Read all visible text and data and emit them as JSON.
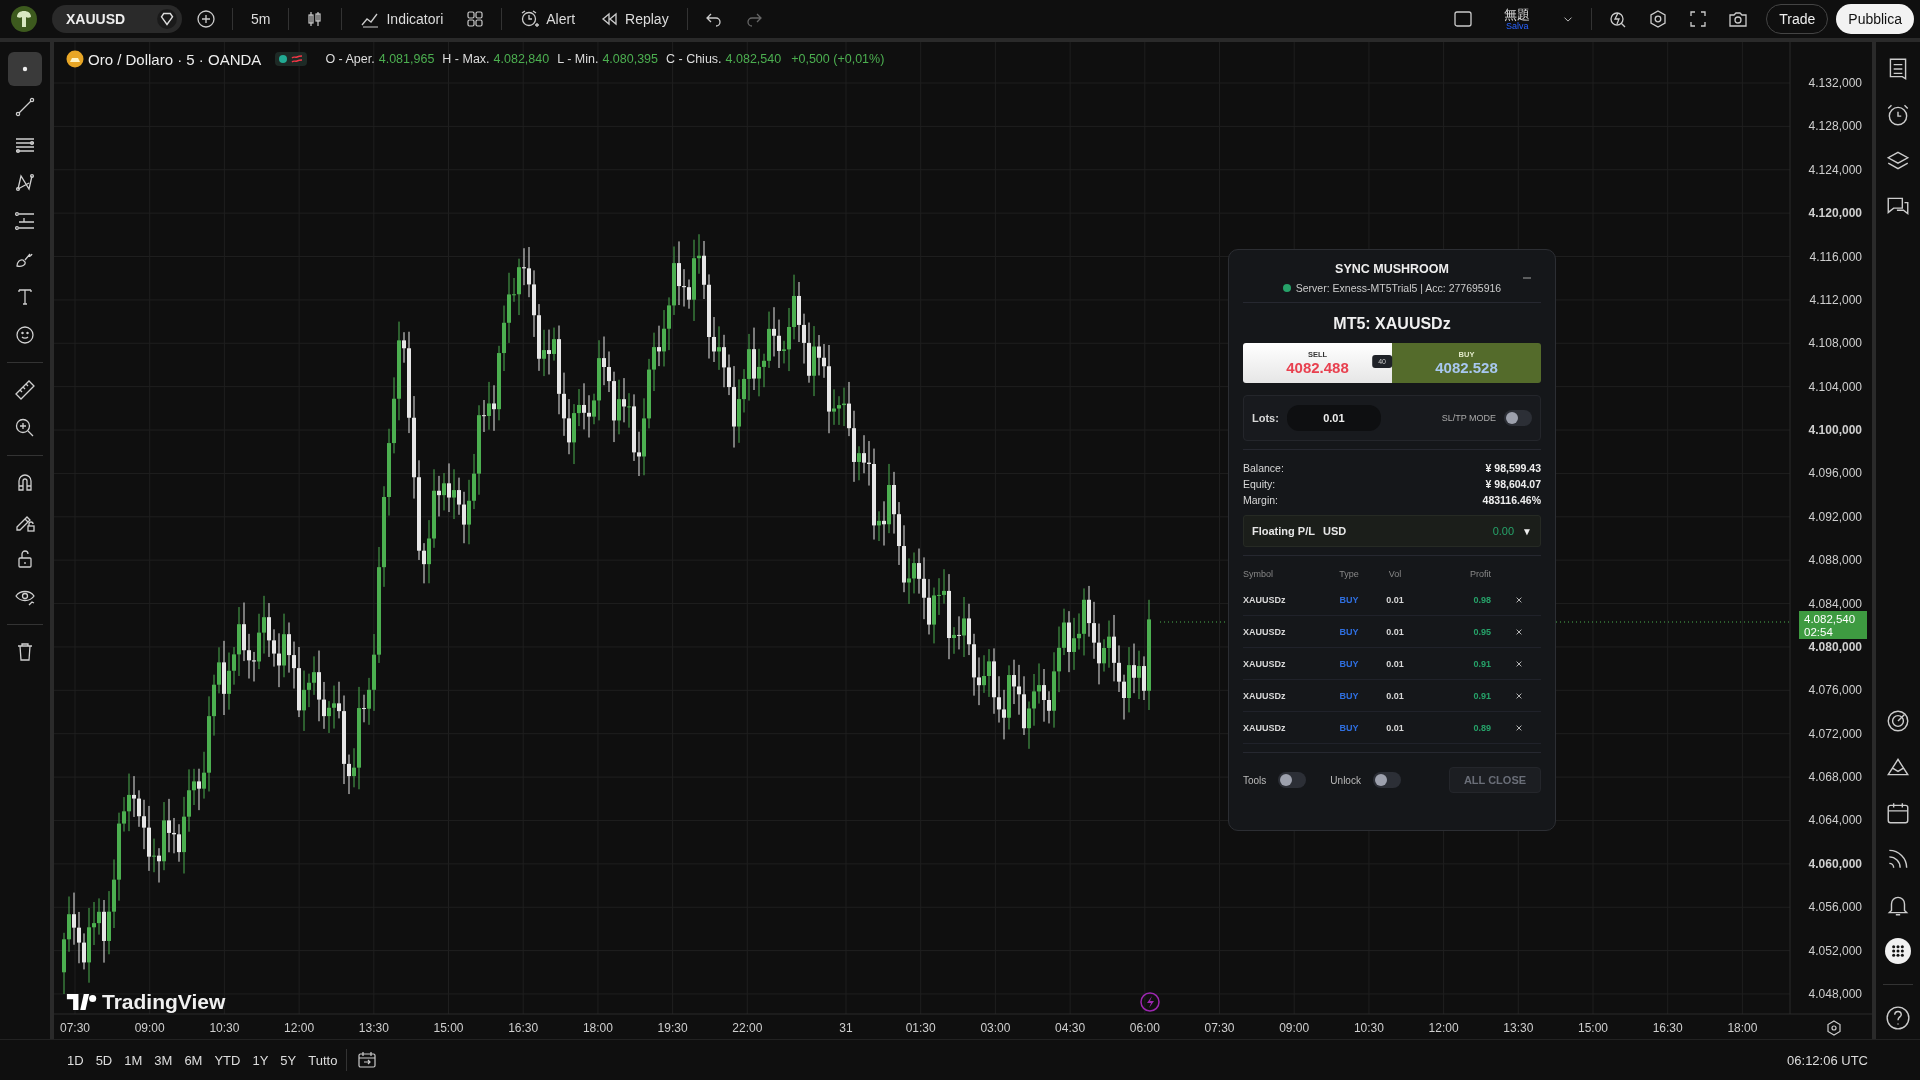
{
  "top_bar": {
    "symbol": "XAUUSD",
    "interval": "5m",
    "indicators": "Indicatori",
    "alert": "Alert",
    "replay": "Replay",
    "layout_name": "無題",
    "layout_status": "Salva",
    "trade": "Trade",
    "publish": "Pubblica"
  },
  "legend": {
    "title": "Oro / Dollaro · 5 · OANDA",
    "market_open": true,
    "values": [
      {
        "label": "O - Aper.",
        "value": "4.081,965"
      },
      {
        "label": "H - Max.",
        "value": "4.082,840"
      },
      {
        "label": "L - Min.",
        "value": "4.080,395"
      },
      {
        "label": "C - Chius.",
        "value": "4.082,540"
      }
    ],
    "change": "+0,500 (+0,01%)"
  },
  "left_toolbar": {
    "tool_groups": [
      [
        {
          "kind": "dot",
          "selected": true
        },
        {
          "kind": "trendline",
          "selected": false
        },
        {
          "kind": "fib",
          "selected": false
        },
        {
          "kind": "pattern",
          "selected": false
        },
        {
          "kind": "projection",
          "selected": false
        },
        {
          "kind": "brush",
          "selected": false
        },
        {
          "kind": "text",
          "selected": false
        },
        {
          "kind": "smiley",
          "selected": false
        }
      ],
      [
        {
          "kind": "ruler",
          "selected": false
        },
        {
          "kind": "zoom",
          "selected": false
        }
      ],
      [
        {
          "kind": "magnet",
          "selected": false
        },
        {
          "kind": "pencil-lock",
          "selected": false
        },
        {
          "kind": "lock",
          "selected": false
        },
        {
          "kind": "eye",
          "selected": false
        }
      ],
      [
        {
          "kind": "trash",
          "selected": false
        }
      ]
    ]
  },
  "price_axis": {
    "ticks": [
      "4.132,000",
      "4.128,000",
      "4.124,000",
      "4.120,000",
      "4.116,000",
      "4.112,000",
      "4.108,000",
      "4.104,000",
      "4.100,000",
      "4.096,000",
      "4.092,000",
      "4.088,000",
      "4.084,000",
      "4.080,000",
      "4.076,000",
      "4.072,000",
      "4.068,000",
      "4.064,000",
      "4.060,000",
      "4.056,000",
      "4.052,000",
      "4.048,000"
    ],
    "current_price": "4.082,540",
    "countdown": "02:54"
  },
  "time_axis": {
    "labels": [
      "07:30",
      "09:00",
      "10:30",
      "12:00",
      "13:30",
      "15:00",
      "16:30",
      "18:00",
      "19:30",
      "22:00",
      "31",
      "01:30",
      "03:00",
      "04:30",
      "06:00",
      "07:30",
      "09:00",
      "10:30",
      "12:00",
      "13:30",
      "15:00",
      "16:30",
      "18:00"
    ]
  },
  "chart_logo": "TradingView",
  "panel": {
    "title": "SYNC MUSHROOM",
    "connected": true,
    "server": "Server: Exness-MT5Trial5 | Acc: 277695916",
    "symbol_title": "MT5: XAUUSDz",
    "sell_label": "SELL",
    "sell_price": "4082.488",
    "spread": "40",
    "buy_label": "BUY",
    "buy_price": "4082.528",
    "lots_label": "Lots:",
    "lots": "0.01",
    "sltp_label": "SL/TP MODE",
    "sltp_on": false,
    "account": [
      {
        "label": "Balance:",
        "value": "¥ 98,599.43"
      },
      {
        "label": "Equity:",
        "value": "¥ 98,604.07"
      },
      {
        "label": "Margin:",
        "value": "483116.46%"
      }
    ],
    "floating_label": "Floating P/L",
    "floating_currency": "USD",
    "floating_value": "0.00",
    "floating_toggle": "▼",
    "columns": [
      "Symbol",
      "Type",
      "Vol",
      "Profit"
    ],
    "positions": [
      {
        "symbol": "XAUUSDz",
        "type": "BUY",
        "vol": "0.01",
        "profit": "0.98"
      },
      {
        "symbol": "XAUUSDz",
        "type": "BUY",
        "vol": "0.01",
        "profit": "0.95"
      },
      {
        "symbol": "XAUUSDz",
        "type": "BUY",
        "vol": "0.01",
        "profit": "0.91"
      },
      {
        "symbol": "XAUUSDz",
        "type": "BUY",
        "vol": "0.01",
        "profit": "0.91"
      },
      {
        "symbol": "XAUUSDz",
        "type": "BUY",
        "vol": "0.01",
        "profit": "0.89"
      }
    ],
    "tools_label": "Tools",
    "tools_on": false,
    "unlock_label": "Unlock",
    "unlock_on": false,
    "close_all": "ALL CLOSE",
    "close_all_disabled": true
  },
  "range_bar": {
    "ranges": [
      "1D",
      "5D",
      "1M",
      "3M",
      "6M",
      "YTD",
      "1Y",
      "5Y",
      "Tutto"
    ],
    "clock": "06:12:06 UTC"
  }
}
